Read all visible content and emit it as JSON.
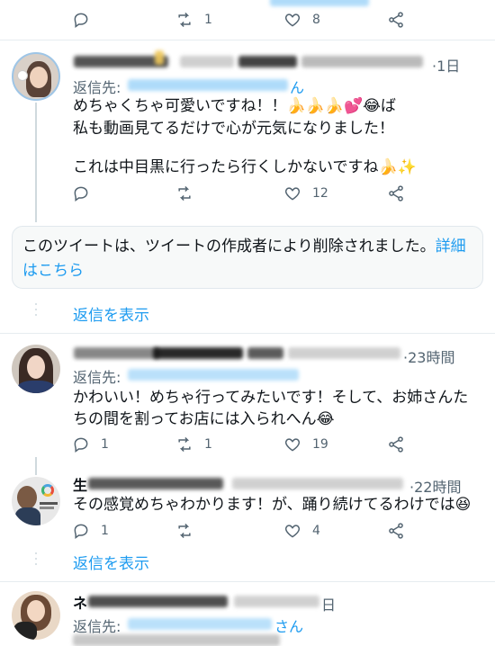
{
  "top_tweet": {
    "replies": "",
    "retweets": "1",
    "likes": "8"
  },
  "tweets": [
    {
      "time": "1日",
      "reply_prefix": "返信先:",
      "reply_handle_suffix": "ん",
      "lines": [
        "めちゃくちゃ可愛いですね！！🍌🍌🍌💕😂ば",
        "私も動画見てるだけで心が元気になりました！",
        "",
        "これは中目黒に行ったら行くしかないですね🍌✨"
      ],
      "replies": "",
      "retweets": "",
      "likes": "12"
    },
    {
      "time": "23時間",
      "reply_prefix": "返信先:",
      "lines": [
        "かわいい！めちゃ行ってみたいです！そして、お姉さんた",
        "ちの間を割ってお店には入られへん😂"
      ],
      "replies": "1",
      "retweets": "1",
      "likes": "19"
    },
    {
      "name_start": "生",
      "time": "22時間",
      "lines": [
        "その感覚めちゃわかります！が、踊り続けてるわけでは😆"
      ],
      "replies": "1",
      "retweets": "",
      "likes": "4"
    },
    {
      "name_start": "ネ",
      "time": "日",
      "reply_prefix": "返信先:",
      "reply_handle_suffix": "さん"
    }
  ],
  "deleted_notice": {
    "text": "このツイートは、ツイートの作成者により削除されました。",
    "link": "詳細はこちら"
  },
  "show_replies": "返信を表示",
  "colors": {
    "accent": "#1d9bf0",
    "muted": "#536471",
    "border": "#e6ecf0",
    "thread": "#cfd9de"
  }
}
